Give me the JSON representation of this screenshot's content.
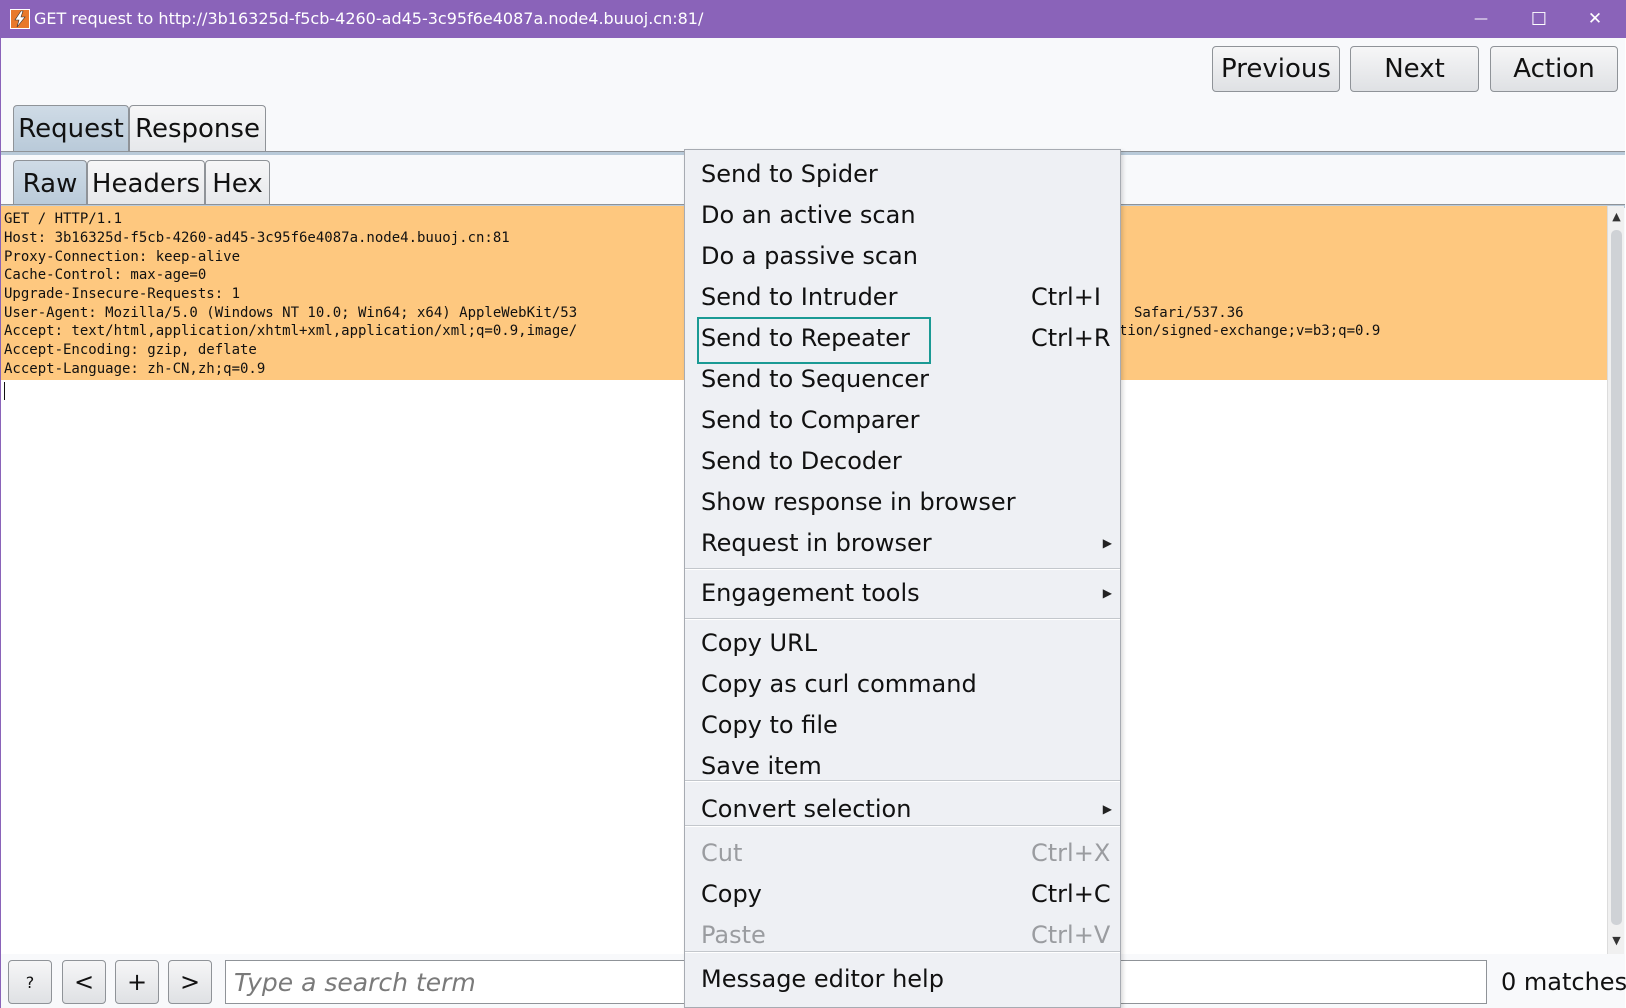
{
  "window": {
    "title": "GET request to http://3b16325d-f5cb-4260-ad45-3c95f6e4087a.node4.buuoj.cn:81/",
    "minimize_glyph": "—",
    "maximize_glyph": "☐",
    "close_glyph": "✕"
  },
  "nav": {
    "previous": "Previous",
    "next": "Next",
    "action": "Action"
  },
  "main_tabs": [
    "Request",
    "Response"
  ],
  "sub_tabs": [
    "Raw",
    "Headers",
    "Hex"
  ],
  "request_lines": [
    "GET / HTTP/1.1",
    "Host: 3b16325d-f5cb-4260-ad45-3c95f6e4087a.node4.buuoj.cn:81",
    "Proxy-Connection: keep-alive",
    "Cache-Control: max-age=0",
    "Upgrade-Insecure-Requests: 1",
    "User-Agent: Mozilla/5.0 (Windows NT 10.0; Win64; x64) AppleWebKit/53",
    "Accept: text/html,application/xhtml+xml,application/xml;q=0.9,image/",
    "Accept-Encoding: gzip, deflate",
    "Accept-Language: zh-CN,zh;q=0.9"
  ],
  "request_line_tails": {
    "user_agent_tail": "Safari/537.36",
    "accept_tail": "tion/signed-exchange;v=b3;q=0.9"
  },
  "context_menu": {
    "items": [
      {
        "label": "Send to Spider",
        "shortcut": ""
      },
      {
        "label": "Do an active scan",
        "shortcut": ""
      },
      {
        "label": "Do a passive scan",
        "shortcut": ""
      },
      {
        "label": "Send to Intruder",
        "shortcut": "Ctrl+I"
      },
      {
        "label": "Send to Repeater",
        "shortcut": "Ctrl+R"
      },
      {
        "label": "Send to Sequencer",
        "shortcut": ""
      },
      {
        "label": "Send to Comparer",
        "shortcut": ""
      },
      {
        "label": "Send to Decoder",
        "shortcut": ""
      },
      {
        "label": "Show response in browser",
        "shortcut": ""
      },
      {
        "label": "Request in browser",
        "shortcut": ""
      },
      {
        "label": "Engagement tools",
        "shortcut": ""
      },
      {
        "label": "Copy URL",
        "shortcut": ""
      },
      {
        "label": "Copy as curl command",
        "shortcut": ""
      },
      {
        "label": "Copy to file",
        "shortcut": ""
      },
      {
        "label": "Save item",
        "shortcut": ""
      },
      {
        "label": "Convert selection",
        "shortcut": ""
      },
      {
        "label": "Cut",
        "shortcut": "Ctrl+X"
      },
      {
        "label": "Copy",
        "shortcut": "Ctrl+C"
      },
      {
        "label": "Paste",
        "shortcut": "Ctrl+V"
      },
      {
        "label": "Message editor help",
        "shortcut": ""
      }
    ],
    "highlighted": "Send to Repeater",
    "accent_color": "#1a9a94"
  },
  "search": {
    "help_label": "?",
    "prev_label": "<",
    "add_label": "+",
    "next_label": ">",
    "placeholder": "Type a search term",
    "matches": "0 matches"
  },
  "colors": {
    "titlebar": "#8a63b9",
    "request_highlight": "#fec87f"
  }
}
